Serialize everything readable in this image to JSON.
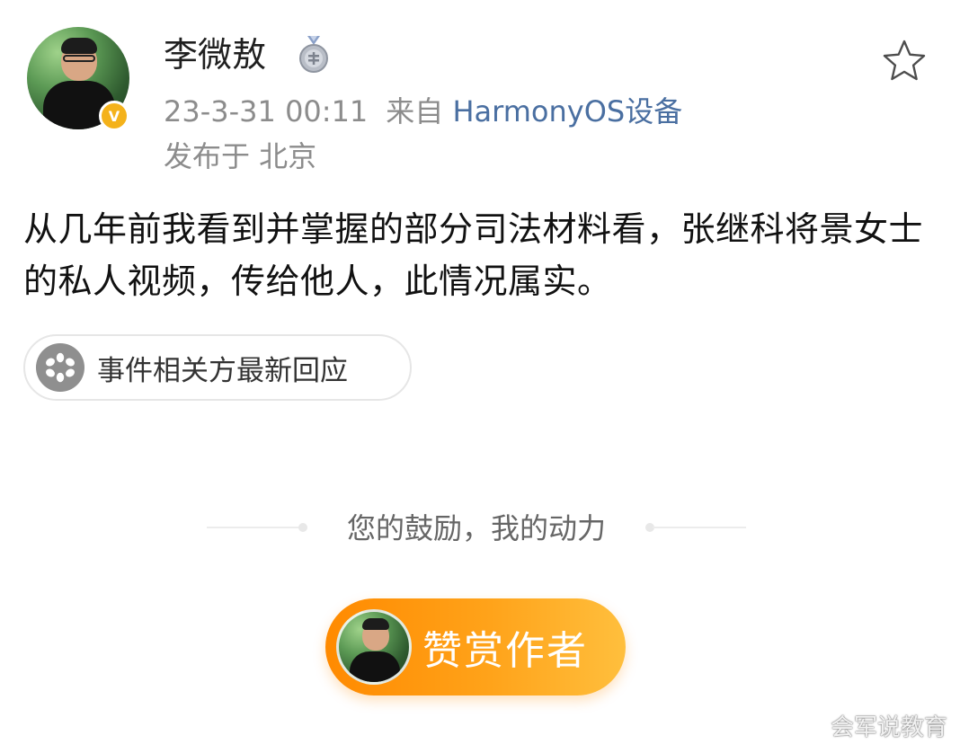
{
  "post": {
    "author": {
      "name": "李微敖",
      "verified_badge": "V",
      "medal_icon": "medal-icon"
    },
    "timestamp": "23-3-31 00:11",
    "source_label": "来自",
    "source_device": "HarmonyOS设备",
    "location": "发布于 北京",
    "content": "从几年前我看到并掌握的部分司法材料看，张继科将景女士的私人视频，传给他人，此情况属实。",
    "topic_chip": {
      "label": "事件相关方最新回应",
      "icon": "asterisk-flower-icon"
    },
    "favorite_icon": "star-outline-icon"
  },
  "reward": {
    "encouragement_text": "您的鼓励，我的动力",
    "button_label": "赞赏作者"
  },
  "watermark": {
    "text": "会军说教育"
  },
  "colors": {
    "link_blue": "#4a6fa1",
    "meta_gray": "#8c8c8c",
    "reward_orange_start": "#ff8a00",
    "reward_orange_end": "#ffbf3d",
    "verified_yellow": "#f4b21b"
  }
}
